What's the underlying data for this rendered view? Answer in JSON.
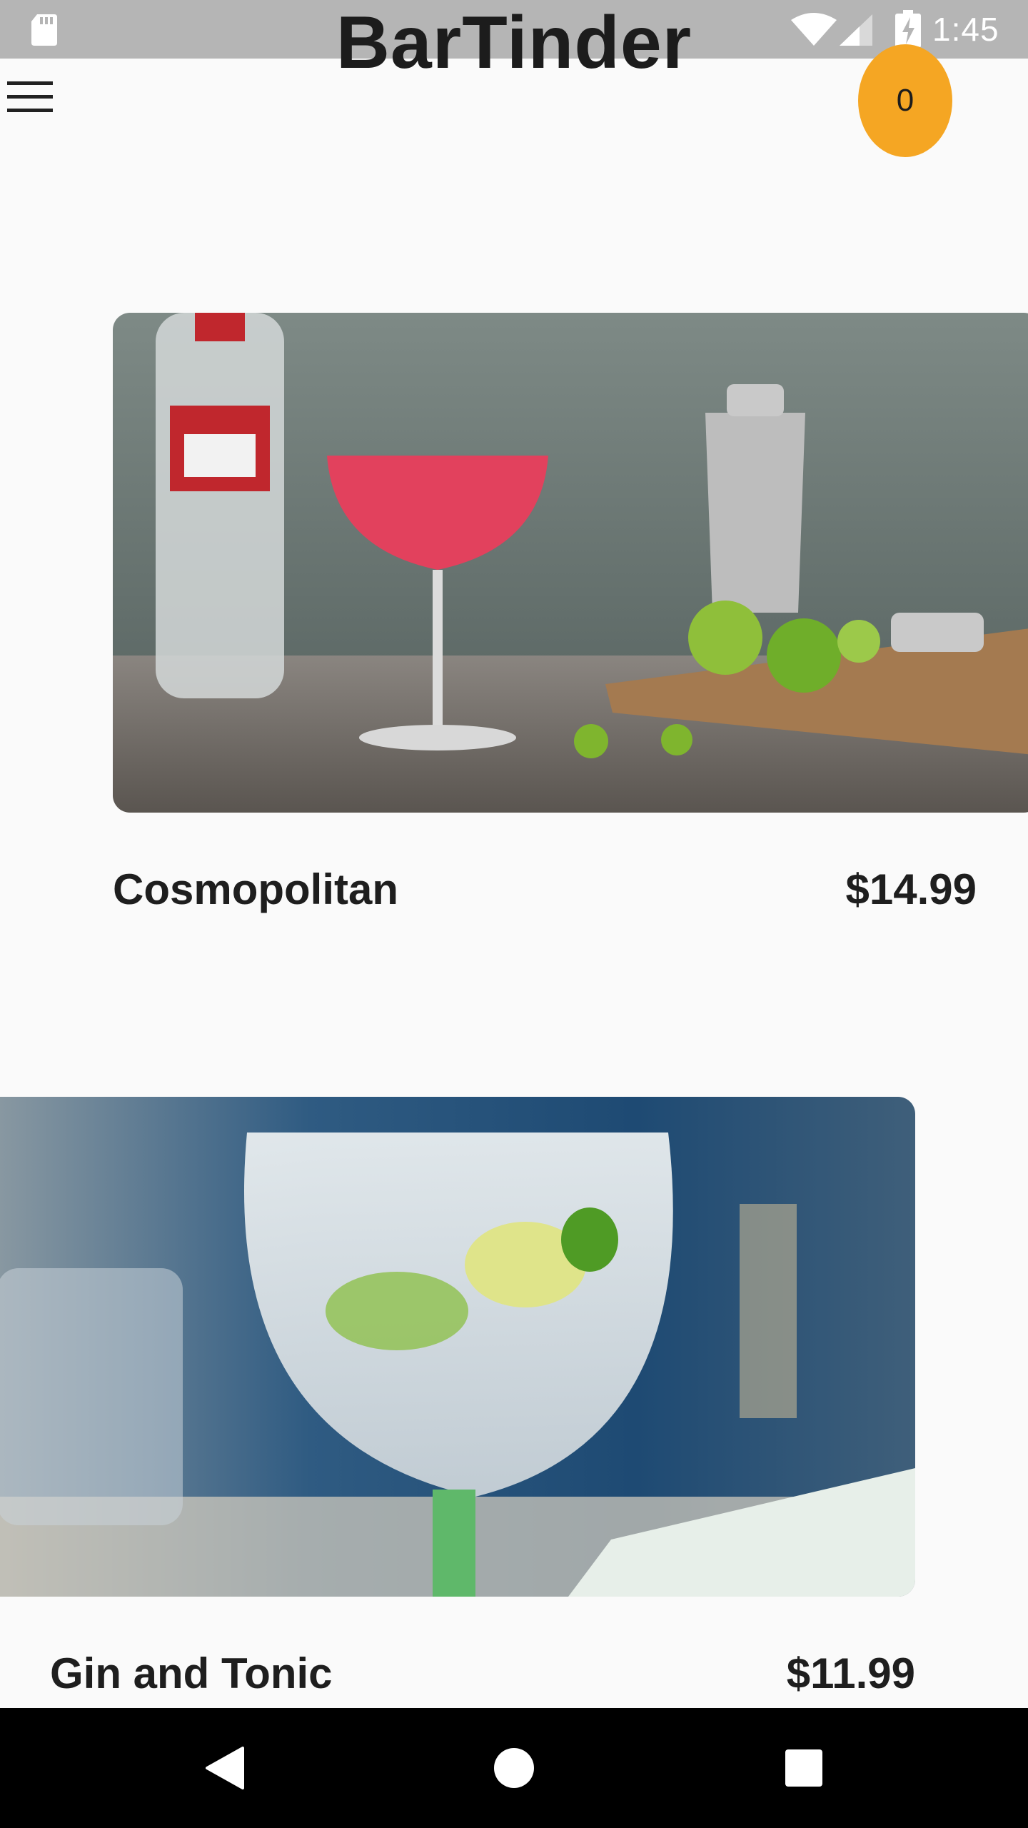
{
  "status_bar": {
    "time": "1:45",
    "icons": [
      "sd-card-icon",
      "wifi-icon",
      "signal-icon",
      "battery-charging-icon"
    ]
  },
  "header": {
    "title": "BarTinder",
    "menu_icon": "menu-icon",
    "cart_count": "0",
    "badge_color": "#f5a623"
  },
  "drinks": [
    {
      "name": "Cosmopolitan",
      "price": "$14.99"
    },
    {
      "name": "Gin and Tonic",
      "price": "$11.99"
    }
  ],
  "nav_bar": {
    "icons": [
      "back-icon",
      "home-icon",
      "recents-icon"
    ]
  }
}
